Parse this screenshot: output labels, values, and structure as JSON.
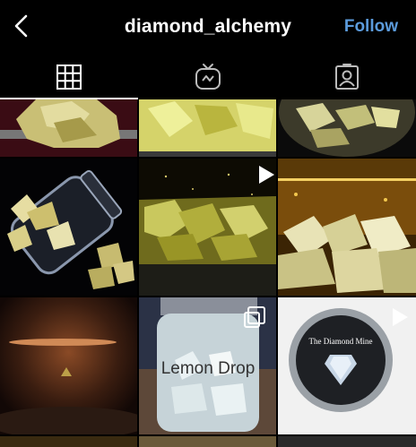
{
  "header": {
    "username": "diamond_alchemy",
    "follow_label": "Follow"
  },
  "tabs": [
    {
      "icon": "grid-icon",
      "active": true
    },
    {
      "icon": "igtv-icon",
      "active": false
    },
    {
      "icon": "tagged-user-icon",
      "active": false
    }
  ],
  "posts": [
    {
      "overlay": "none"
    },
    {
      "overlay": "none"
    },
    {
      "overlay": "none"
    },
    {
      "overlay": "none"
    },
    {
      "overlay": "video"
    },
    {
      "overlay": "none"
    },
    {
      "overlay": "none"
    },
    {
      "overlay": "carousel",
      "label_text": "Lemon Drop"
    },
    {
      "overlay": "video",
      "label_text": "The Diamond Mine"
    }
  ],
  "colors": {
    "follow": "#5b9bdc",
    "background": "#000000",
    "text": "#ffffff"
  }
}
